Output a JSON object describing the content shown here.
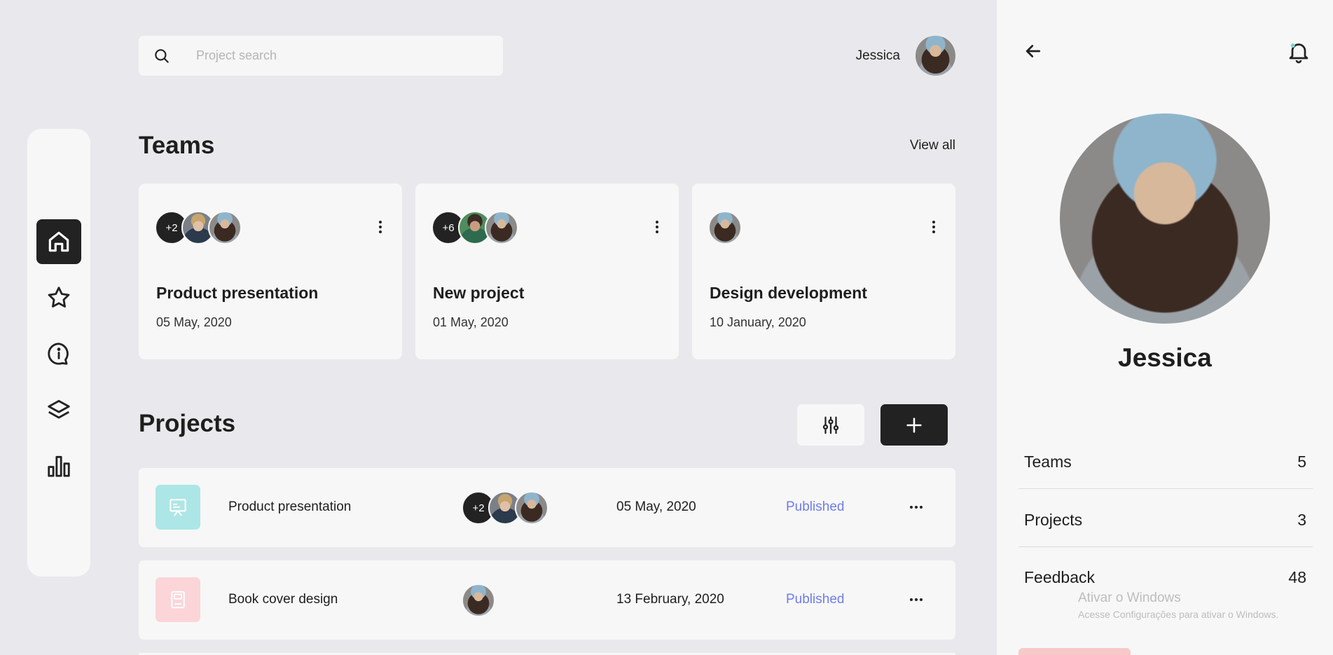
{
  "search": {
    "placeholder": "Project search"
  },
  "user": {
    "name": "Jessica"
  },
  "sidebar": {
    "items": [
      {
        "icon": "home-icon",
        "active": true
      },
      {
        "icon": "star-icon",
        "active": false
      },
      {
        "icon": "info-chat-icon",
        "active": false
      },
      {
        "icon": "layers-icon",
        "active": false
      },
      {
        "icon": "bar-chart-icon",
        "active": false
      }
    ]
  },
  "teams": {
    "title": "Teams",
    "view_all": "View all",
    "cards": [
      {
        "title": "Product presentation",
        "date": "05 May, 2020",
        "extra_count": "+2"
      },
      {
        "title": "New project",
        "date": "01 May, 2020",
        "extra_count": "+6"
      },
      {
        "title": "Design development",
        "date": "10 January, 2020",
        "extra_count": ""
      }
    ]
  },
  "projects": {
    "title": "Projects",
    "rows": [
      {
        "name": "Product presentation",
        "extra_count": "+2",
        "date": "05 May, 2020",
        "status": "Published",
        "thumb_color": "#ade6e6",
        "icon": "presentation-board-icon"
      },
      {
        "name": "Book cover design",
        "extra_count": "",
        "date": "13 February, 2020",
        "status": "Published",
        "thumb_color": "#fbd5d7",
        "icon": "book-icon"
      }
    ]
  },
  "profile": {
    "name": "Jessica",
    "stats": [
      {
        "label": "Teams",
        "value": "5"
      },
      {
        "label": "Projects",
        "value": "3"
      },
      {
        "label": "Feedback",
        "value": "48"
      }
    ]
  },
  "watermark": {
    "line1": "Ativar o Windows",
    "line2": "Acesse Configurações para ativar o Windows."
  }
}
